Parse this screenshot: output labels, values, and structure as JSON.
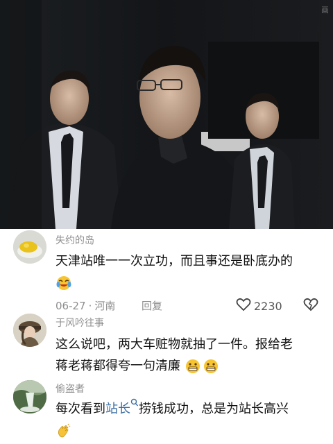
{
  "video": {
    "watermark": "画"
  },
  "comments": [
    {
      "username": "失约的岛",
      "text": "天津站唯一一次立功，而且事还是卧底办的",
      "emoji": "laugh-cry-emoji",
      "date": "06-27",
      "location": "河南",
      "reply_label": "回复",
      "likes": "2230"
    },
    {
      "username": "于风吟往事",
      "text_line1": "这么说吧，两大车赃物就抽了一件。报给老",
      "text_line2": "蒋老蒋都得夸一句清廉",
      "emoji": "grimace-emoji"
    },
    {
      "username": "偷盗者",
      "text_before": "每次看到",
      "link_text": "站长",
      "text_after": "捞钱成功，总是为站长高兴",
      "emoji": "clap-emoji"
    }
  ],
  "colors": {
    "username": "#8e8e8e",
    "link": "#3a6ea5",
    "text": "#111111"
  }
}
